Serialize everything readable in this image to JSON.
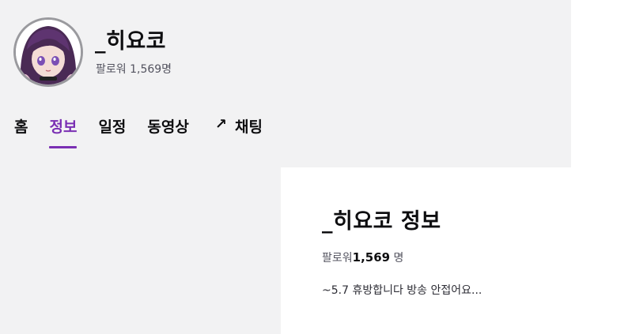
{
  "channel": {
    "name": "_히요코",
    "followers_text": "팔로워 1,569명"
  },
  "tabs": [
    {
      "label": "홈"
    },
    {
      "label": "정보"
    },
    {
      "label": "일정"
    },
    {
      "label": "동영상"
    },
    {
      "label": "채팅",
      "icon": "external-arrow-icon"
    }
  ],
  "info": {
    "title": "_히요코 정보",
    "followers_label": "팔로워",
    "followers_count": "1,569",
    "followers_unit": " 명",
    "description": "~5.7 휴방합니다 방송 안접어요..."
  },
  "colors": {
    "accent": "#7a2fb3",
    "header_bg": "#f2f2f3",
    "text": "#0e0e10",
    "muted": "#53535f"
  }
}
